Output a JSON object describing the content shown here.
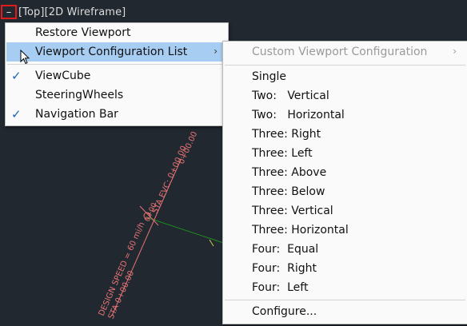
{
  "viewport_controls": {
    "minus": "[–]",
    "view": "[Top]",
    "style": "[2D Wireframe]"
  },
  "context_menu": {
    "items": [
      {
        "label": "Restore Viewport",
        "checked": false
      },
      {
        "label": "Viewport Configuration List",
        "checked": false,
        "highlighted": true,
        "has_submenu": true
      },
      {
        "label": "ViewCube",
        "checked": true
      },
      {
        "label": "SteeringWheels",
        "checked": false
      },
      {
        "label": "Navigation Bar",
        "checked": true
      }
    ],
    "check_glyph": "✓",
    "submenu_arrow": "›"
  },
  "submenu": {
    "header": "Custom Viewport Configuration",
    "items": [
      "Single",
      "Two:   Vertical",
      "Two:   Horizontal",
      "Three: Right",
      "Three: Left",
      "Three: Above",
      "Three: Below",
      "Three: Vertical",
      "Three: Horizontal",
      "Four:  Equal",
      "Four:  Right",
      "Four:  Left"
    ],
    "footer": "Configure..."
  },
  "drawing": {
    "label_top": "0+00.00",
    "label_design_speed": "DESIGN SPEED = 60 mi/h",
    "label_sta": "STA 0+00.00",
    "label_bvcp": "0+00",
    "label_evc": "STA EVC: 0+00.00",
    "colors": {
      "alignment": "#e87474",
      "axis_x": "#1e8c1e",
      "background": "#212830"
    }
  }
}
